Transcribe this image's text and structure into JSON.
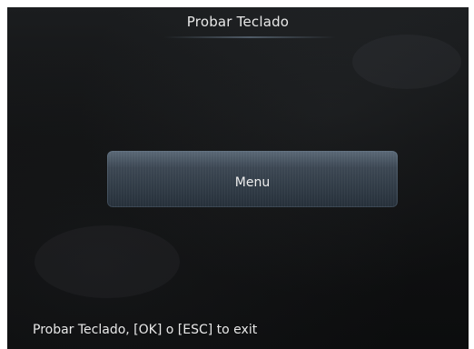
{
  "screen": {
    "title": "Probar Teclado"
  },
  "menu_button": {
    "label": "Menu"
  },
  "status": {
    "text": "Probar Teclado, [OK] o [ESC] to exit"
  },
  "colors": {
    "background": "#101112",
    "text": "#e8e8e8",
    "button_top": "#5b6977",
    "button_bottom": "#26303a"
  }
}
